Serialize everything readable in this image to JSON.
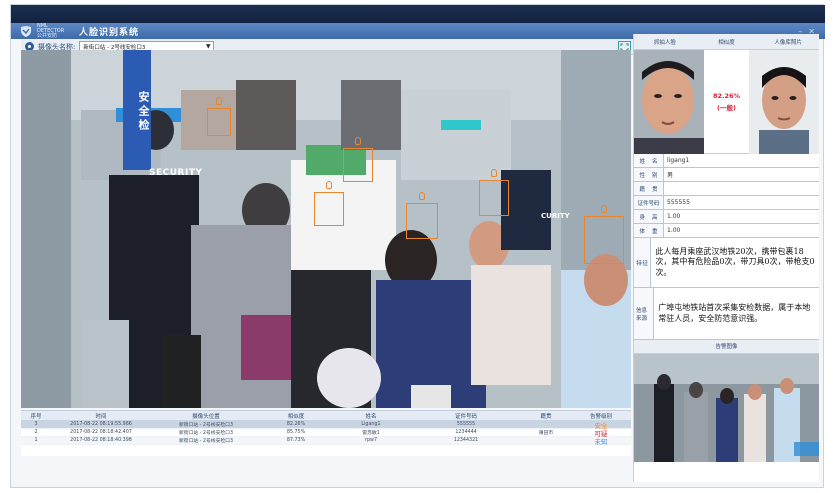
{
  "app": {
    "logo_text": "NML DETECTOR 公共安防",
    "title": "人脸识别系统"
  },
  "camera_bar": {
    "label": "摄像头名称:",
    "selected": "新街口站 - 2号线安检口3"
  },
  "video": {
    "sign_text": "安全检",
    "security_text": "SECURITY",
    "curity_text": "CURITY"
  },
  "table": {
    "headers": [
      "序号",
      "时间",
      "摄像头位置",
      "相似度",
      "姓名",
      "证件号码",
      "籍贯",
      "告警级别"
    ],
    "rows": [
      {
        "no": "3",
        "time": "2017-08-22 08:19:55.986",
        "loc": "新街口站 - 2号线安检口3",
        "sim": "82.26%",
        "name": "Ligang1",
        "id": "555555",
        "native": "",
        "level": "安全",
        "level_color": "#e8862f"
      },
      {
        "no": "2",
        "time": "2017-08-22 08:18:42.407",
        "loc": "新街口站 - 2号线安检口3",
        "sim": "85.75%",
        "name": "雷苏敏1",
        "id": "1234444",
        "native": "莆田市",
        "level": "可疑",
        "level_color": "#d3243b"
      },
      {
        "no": "1",
        "time": "2017-08-22 08:18:40.398",
        "loc": "新街口站 - 2号线安检口3",
        "sim": "87.73%",
        "name": "rpw7",
        "id": "12344321",
        "native": "",
        "level": "未知",
        "level_color": "#4a8fd1"
      }
    ]
  },
  "panel": {
    "headers": [
      "抓拍人脸",
      "相似度",
      "人像库照片"
    ],
    "similarity": "82.26%",
    "level": "(一般)",
    "fields": [
      {
        "label": [
          "姓",
          "名"
        ],
        "value": "ligang1"
      },
      {
        "label": [
          "性",
          "别"
        ],
        "value": "男"
      },
      {
        "label": [
          "籍",
          "贯"
        ],
        "value": ""
      },
      {
        "label": [
          "证件号码"
        ],
        "value": "555555"
      },
      {
        "label": [
          "身",
          "高"
        ],
        "value": "1.00"
      },
      {
        "label": [
          "体",
          "重"
        ],
        "value": "1.00"
      }
    ],
    "feature_label": [
      "特",
      "征"
    ],
    "feature_text": "此人每月乘座武汉地铁20次，携带包裹18次，其中有危险品0次，带刀具0次，带枪支0次。",
    "source_label": "信息来源",
    "source_text": "广埠屯地铁站首次采集安检数据，属于本地常驻人员，安全防范意识强。",
    "alarm_title": "告警图像"
  }
}
